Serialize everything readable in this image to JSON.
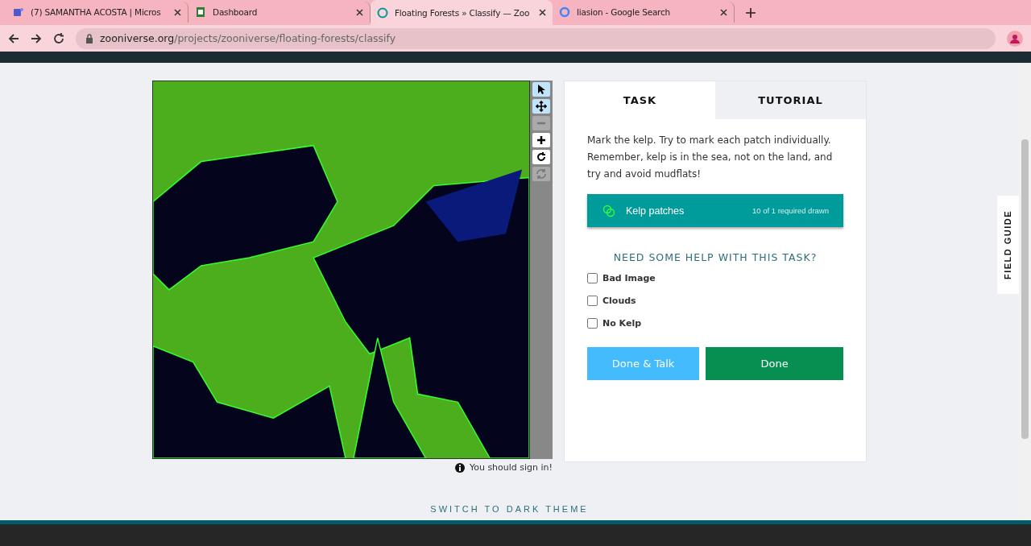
{
  "browser": {
    "tabs": [
      {
        "title": "(7) SAMANTHA ACOSTA | Micros",
        "selected": false
      },
      {
        "title": "Dashboard",
        "selected": false
      },
      {
        "title": "Floating Forests » Classify — Zoo",
        "selected": true
      },
      {
        "title": "liasion - Google Search",
        "selected": false
      }
    ],
    "url_host": "zooniverse.org",
    "url_path": "/projects/zooniverse/floating-forests/classify"
  },
  "tools": [
    {
      "kind": "pointer",
      "selected": true,
      "disabled": false
    },
    {
      "kind": "move",
      "selected": true,
      "disabled": false
    },
    {
      "kind": "zoom-out",
      "selected": false,
      "disabled": true
    },
    {
      "kind": "zoom-in",
      "selected": false,
      "disabled": false
    },
    {
      "kind": "rotate",
      "selected": false,
      "disabled": false
    },
    {
      "kind": "reset",
      "selected": false,
      "disabled": true
    }
  ],
  "sign_in_note": "You should sign in!",
  "panel": {
    "tabs": [
      {
        "label": "TASK",
        "selected": true
      },
      {
        "label": "TUTORIAL",
        "selected": false
      }
    ],
    "instruction": "Mark the kelp. Try to mark each patch individually. Remember, kelp is in the sea, not on the land, and try and avoid mudflats!",
    "drawing_tool": {
      "label": "Kelp patches",
      "count": "10 of 1 required drawn"
    },
    "help_heading": "NEED SOME HELP WITH THIS TASK?",
    "options": [
      {
        "label": "Bad Image",
        "checked": false
      },
      {
        "label": "Clouds",
        "checked": false
      },
      {
        "label": "No Kelp",
        "checked": false
      }
    ],
    "buttons": [
      {
        "label": "Done & Talk",
        "kind": "talk"
      },
      {
        "label": "Done",
        "kind": "done"
      }
    ]
  },
  "field_guide": "FIELD GUIDE",
  "theme_switch": "SWITCH TO DARK THEME"
}
